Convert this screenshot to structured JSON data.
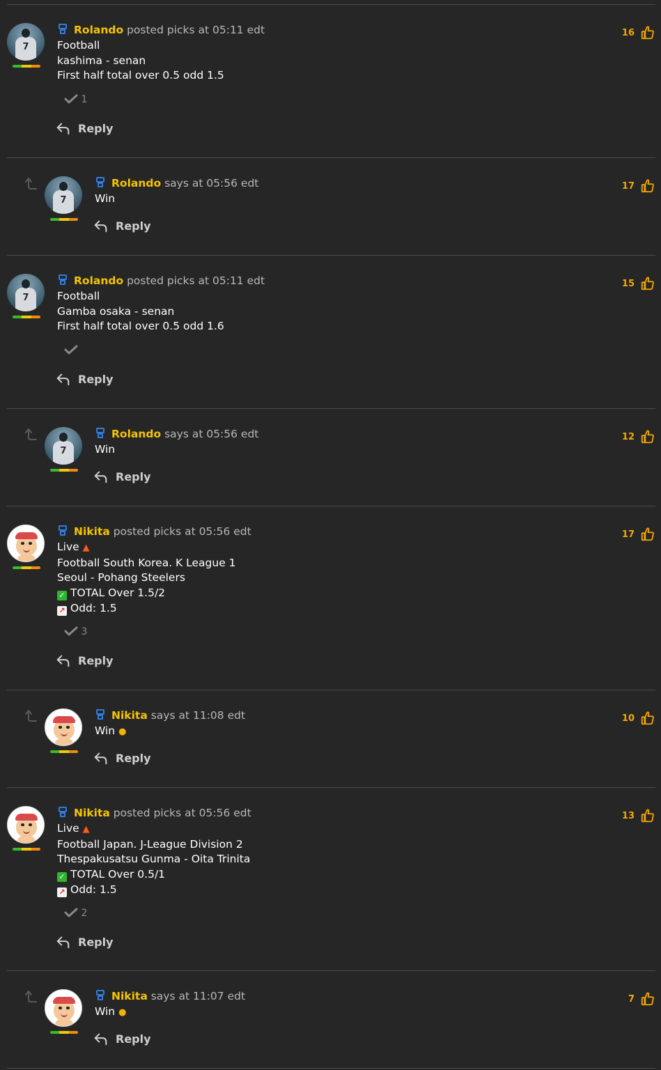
{
  "posts": [
    {
      "user": "Rolando",
      "action": "posted picks at 05:11 edt",
      "lines": [
        "Football",
        "kashima - senan",
        "First half total over 0.5 odd 1.5"
      ],
      "confirms": "1",
      "reply": "Reply",
      "likes": "16"
    },
    {
      "user": "Rolando",
      "action": "says at 05:56 edt",
      "lines": [
        "Win"
      ],
      "reply": "Reply",
      "likes": "17"
    },
    {
      "user": "Rolando",
      "action": "posted picks at 05:11 edt",
      "lines": [
        "Football",
        "Gamba osaka - senan",
        "First half total over 0.5 odd 1.6"
      ],
      "confirms": "",
      "reply": "Reply",
      "likes": "15"
    },
    {
      "user": "Rolando",
      "action": "says at 05:56 edt",
      "lines": [
        "Win"
      ],
      "reply": "Reply",
      "likes": "12"
    },
    {
      "user": "Nikita",
      "action": "posted picks at 05:56 edt",
      "lines": [
        "Live",
        "Football South Korea. K League 1",
        "Seoul - Pohang Steelers",
        "TOTAL Over 1.5/2",
        "Odd: 1.5"
      ],
      "confirms": "3",
      "reply": "Reply",
      "likes": "17"
    },
    {
      "user": "Nikita",
      "action": "says at 11:08 edt",
      "lines": [
        "Win"
      ],
      "reply": "Reply",
      "likes": "10"
    },
    {
      "user": "Nikita",
      "action": "posted picks at 05:56 edt",
      "lines": [
        "Live",
        "Football Japan. J-League Division 2",
        "Thespakusatsu Gunma - Oita Trinita",
        "TOTAL Over 0.5/1",
        "Odd: 1.5"
      ],
      "confirms": "2",
      "reply": "Reply",
      "likes": "13"
    },
    {
      "user": "Nikita",
      "action": "says at 11:07 edt",
      "lines": [
        "Win"
      ],
      "reply": "Reply",
      "likes": "7"
    }
  ],
  "colors": {
    "background": "#262626",
    "username": "#f5c400",
    "likes": "#f5a800"
  },
  "icons": [
    "user-badge-icon",
    "checkmark-icon",
    "reply-arrow-icon",
    "thumbs-up-icon",
    "thread-reply-icon",
    "fire-emoji",
    "check-mark-button-emoji",
    "chart-increasing-emoji",
    "medal-emoji"
  ]
}
